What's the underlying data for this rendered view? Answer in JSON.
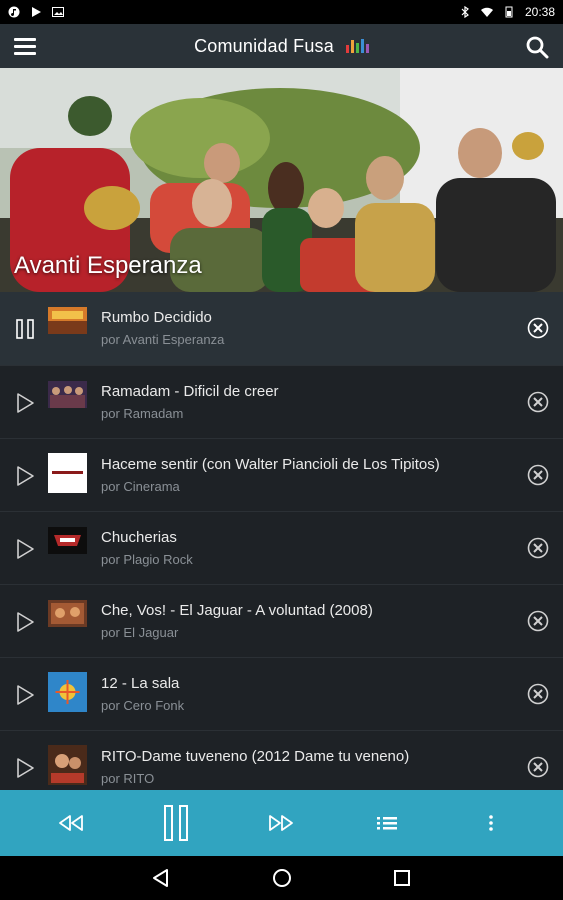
{
  "status_bar": {
    "time": "20:38"
  },
  "app_bar": {
    "title": "Comunidad Fusa",
    "logo_colors": [
      "#e23b3b",
      "#f2a33a",
      "#4fb848",
      "#3b8fd6",
      "#9b59b6"
    ]
  },
  "hero": {
    "artist": "Avanti Esperanza"
  },
  "colors": {
    "accent": "#31a4c0",
    "app_bar": "#2a3238",
    "list_bg": "#1e2226"
  },
  "tracks": [
    {
      "title": "Rumbo Decidido",
      "artist": "por Avanti Esperanza",
      "state": "playing",
      "thumb": "#b5651d"
    },
    {
      "title": "Ramadam - Dificil de creer",
      "artist": "por Ramadam",
      "state": "paused",
      "thumb": "#5a4a6a"
    },
    {
      "title": "Haceme sentir (con Walter Piancioli de Los Tipitos)",
      "artist": "por Cinerama",
      "state": "paused",
      "thumb": "#ffffff"
    },
    {
      "title": "Chucherias",
      "artist": "por Plagio Rock",
      "state": "paused",
      "thumb": "#111111"
    },
    {
      "title": "Che, Vos! - El Jaguar - A voluntad (2008)",
      "artist": "por El Jaguar",
      "state": "paused",
      "thumb": "#7a4a2a"
    },
    {
      "title": "12 - La sala",
      "artist": "por Cero Fonk",
      "state": "paused",
      "thumb": "#3a8ac8"
    },
    {
      "title": "RITO-Dame tuveneno (2012 Dame tu veneno)",
      "artist": "por RITO",
      "state": "paused",
      "thumb": "#8a5a3a"
    }
  ],
  "icons": {
    "menu": "menu-icon",
    "search": "search-icon",
    "play": "play-icon",
    "pause": "pause-icon",
    "remove": "close-circle-icon",
    "rewind": "rewind-icon",
    "fast_forward": "fast-forward-icon",
    "playlist": "playlist-icon",
    "more": "more-vert-icon",
    "back": "back-icon",
    "home": "home-icon",
    "recents": "recents-icon"
  }
}
